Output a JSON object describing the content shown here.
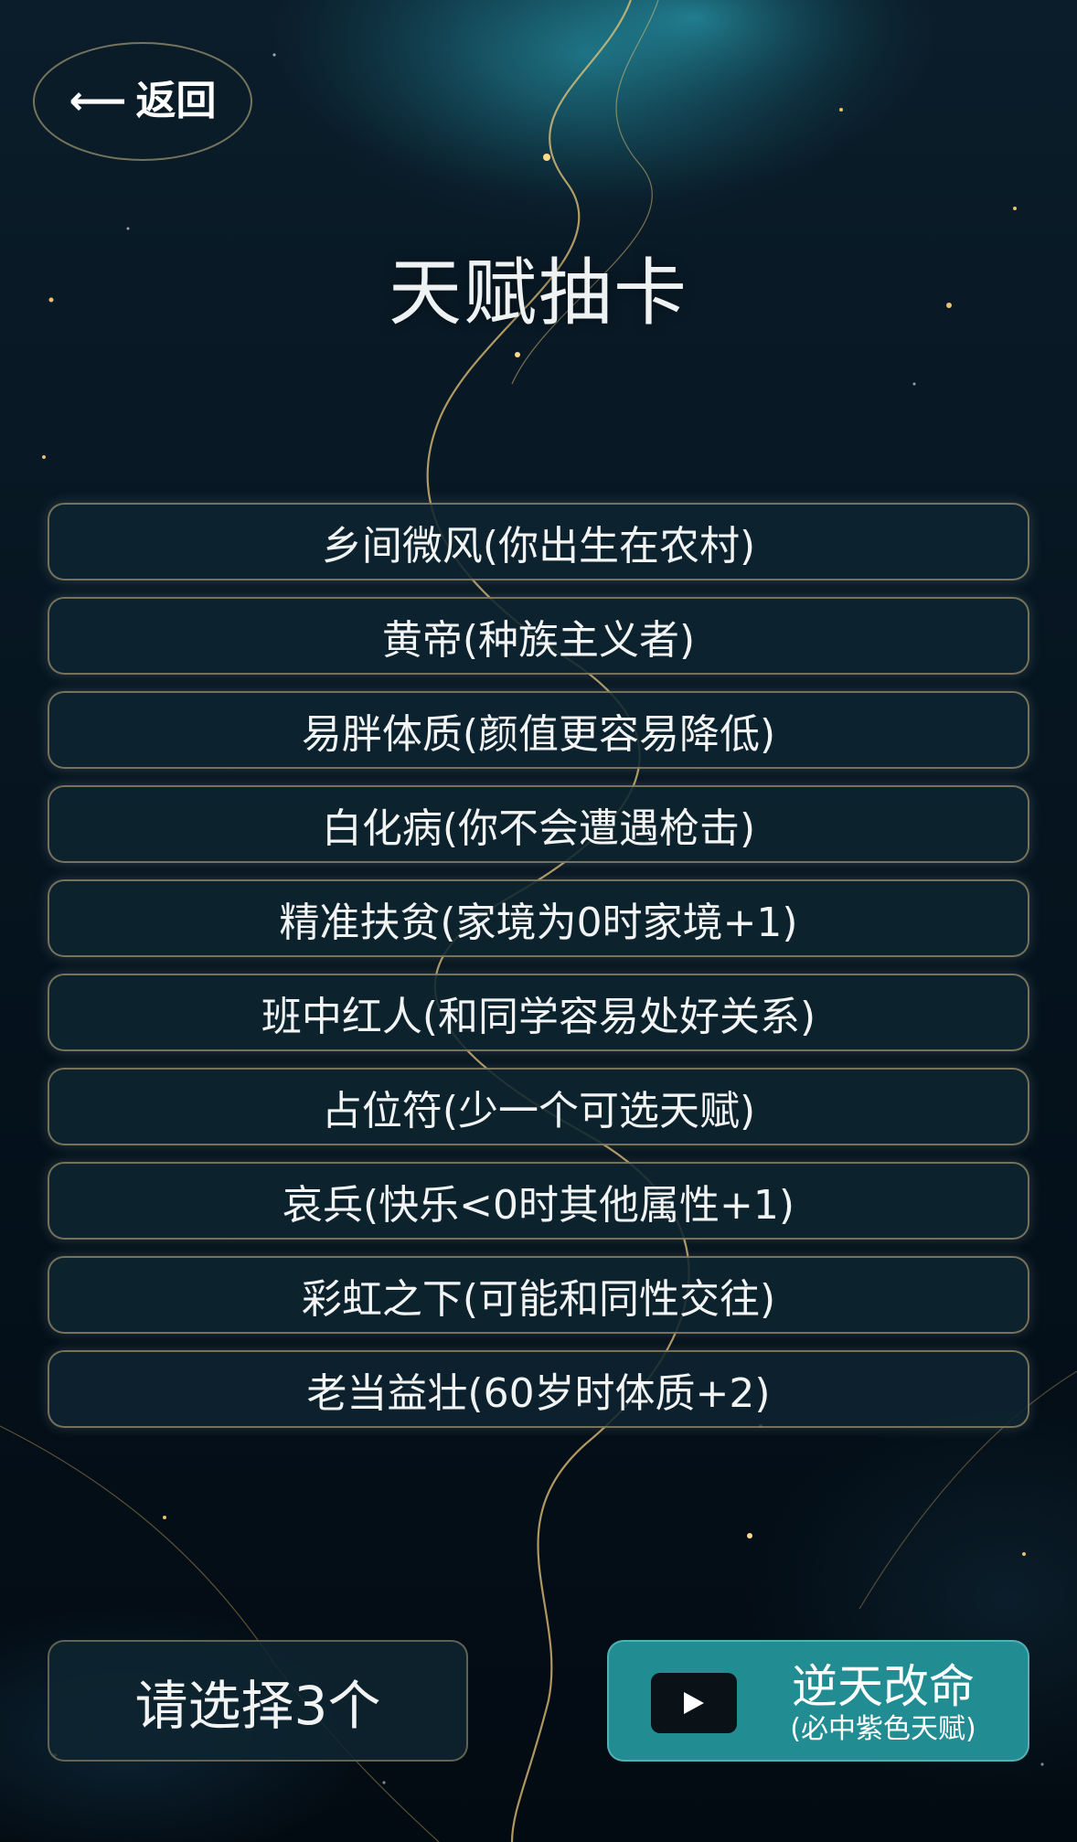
{
  "header": {
    "back_arrow": "⟵",
    "back_label": "返回",
    "title": "天赋抽卡"
  },
  "talents": [
    {
      "label": "乡间微风(你出生在农村)"
    },
    {
      "label": "黄帝(种族主义者)"
    },
    {
      "label": "易胖体质(颜值更容易降低)"
    },
    {
      "label": "白化病(你不会遭遇枪击)"
    },
    {
      "label": "精准扶贫(家境为0时家境+1)"
    },
    {
      "label": "班中红人(和同学容易处好关系)"
    },
    {
      "label": "占位符(少一个可选天赋)"
    },
    {
      "label": "哀兵(快乐<0时其他属性+1)"
    },
    {
      "label": "彩虹之下(可能和同性交往)"
    },
    {
      "label": "老当益壮(60岁时体质+2)"
    }
  ],
  "footer": {
    "select_status": "请选择3个",
    "ad_button": {
      "title": "逆天改命",
      "subtitle": "(必中紫色天赋)",
      "icon": "play-icon"
    }
  },
  "colors": {
    "card_border": "#cdb482",
    "card_fill": "#0e2430",
    "accent_teal": "#218d93",
    "background": "#061520"
  }
}
